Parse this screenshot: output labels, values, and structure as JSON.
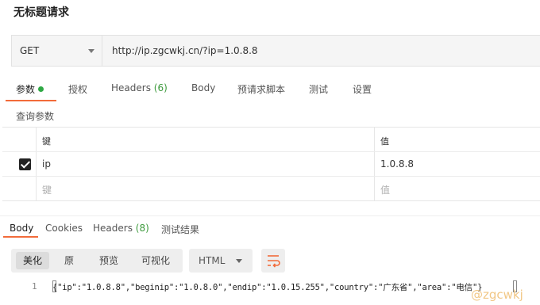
{
  "request": {
    "title": "无标题请求",
    "method": "GET",
    "url": "http://ip.zgcwkj.cn/?ip=1.0.8.8"
  },
  "request_tabs": [
    {
      "label": "参数"
    },
    {
      "label": "授权"
    },
    {
      "label": "Headers",
      "count": "(6)"
    },
    {
      "label": "Body"
    },
    {
      "label": "预请求脚本"
    },
    {
      "label": "测试"
    },
    {
      "label": "设置"
    }
  ],
  "params": {
    "section_label": "查询参数",
    "key_header": "键",
    "value_header": "值",
    "rows": [
      {
        "key": "ip",
        "value": "1.0.8.8",
        "checked": true
      }
    ],
    "placeholder_key": "键",
    "placeholder_value": "值"
  },
  "response_tabs": [
    {
      "label": "Body"
    },
    {
      "label": "Cookies"
    },
    {
      "label": "Headers",
      "count": "(8)"
    },
    {
      "label": "测试结果"
    }
  ],
  "response_toolbar": {
    "view_modes": [
      "美化",
      "原",
      "预览",
      "可视化"
    ],
    "format": "HTML",
    "wrap_icon": "wrap-lines-icon"
  },
  "response_body": {
    "line_number": "1",
    "text": "{\"ip\":\"1.0.8.8\",\"beginip\":\"1.0.8.0\",\"endip\":\"1.0.15.255\",\"country\":\"广东省\",\"area\":\"电信\"}"
  },
  "watermark": "@zgcwkj",
  "colors": {
    "accent": "#f26b3a",
    "enabled_dot": "#2ea844",
    "count_green": "#3c9a3c"
  }
}
